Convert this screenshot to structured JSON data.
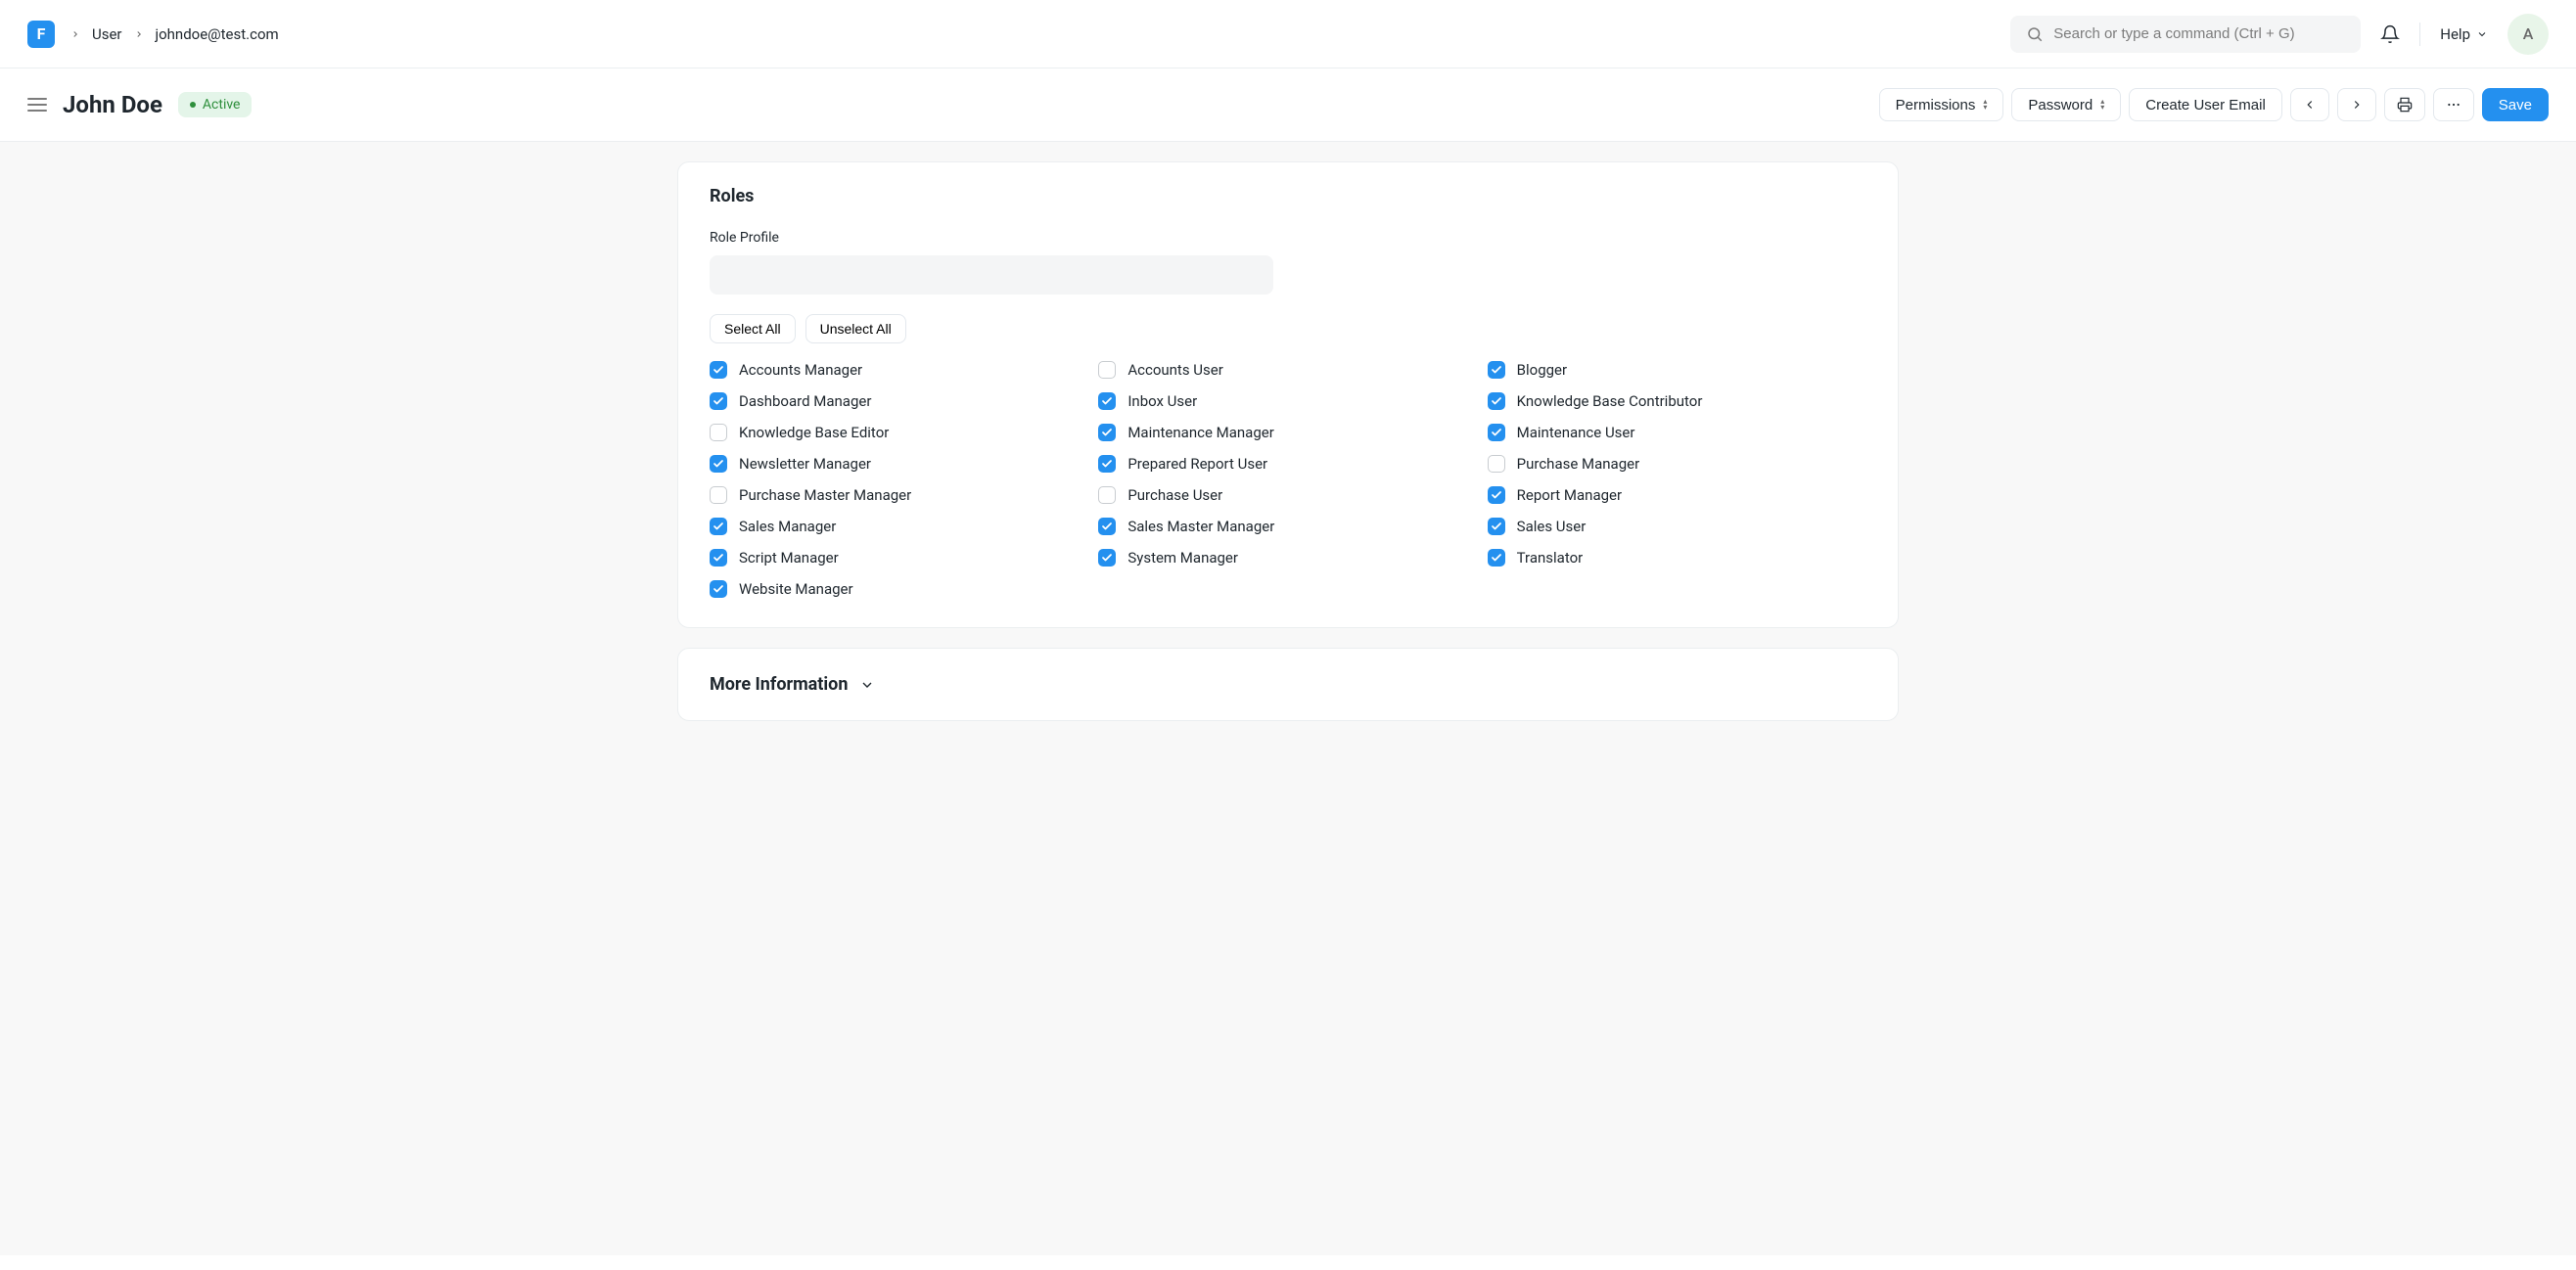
{
  "colors": {
    "primary": "#2490ef",
    "status_bg": "#e4f5e9",
    "status_fg": "#2e8f3c"
  },
  "navbar": {
    "logo_letter": "F",
    "breadcrumb": [
      "User",
      "johndoe@test.com"
    ],
    "search_placeholder": "Search or type a command (Ctrl + G)",
    "help_label": "Help",
    "avatar_letter": "A"
  },
  "header": {
    "title": "John Doe",
    "status": "Active",
    "permissions_label": "Permissions",
    "password_label": "Password",
    "create_email_label": "Create User Email",
    "save_label": "Save"
  },
  "roles": {
    "section_title": "Roles",
    "profile_label": "Role Profile",
    "profile_value": "",
    "select_all": "Select All",
    "unselect_all": "Unselect All",
    "items": [
      {
        "label": "Accounts Manager",
        "checked": true
      },
      {
        "label": "Accounts User",
        "checked": false
      },
      {
        "label": "Blogger",
        "checked": true
      },
      {
        "label": "Dashboard Manager",
        "checked": true
      },
      {
        "label": "Inbox User",
        "checked": true
      },
      {
        "label": "Knowledge Base Contributor",
        "checked": true
      },
      {
        "label": "Knowledge Base Editor",
        "checked": false
      },
      {
        "label": "Maintenance Manager",
        "checked": true
      },
      {
        "label": "Maintenance User",
        "checked": true
      },
      {
        "label": "Newsletter Manager",
        "checked": true
      },
      {
        "label": "Prepared Report User",
        "checked": true
      },
      {
        "label": "Purchase Manager",
        "checked": false
      },
      {
        "label": "Purchase Master Manager",
        "checked": false
      },
      {
        "label": "Purchase User",
        "checked": false
      },
      {
        "label": "Report Manager",
        "checked": true
      },
      {
        "label": "Sales Manager",
        "checked": true
      },
      {
        "label": "Sales Master Manager",
        "checked": true
      },
      {
        "label": "Sales User",
        "checked": true
      },
      {
        "label": "Script Manager",
        "checked": true
      },
      {
        "label": "System Manager",
        "checked": true
      },
      {
        "label": "Translator",
        "checked": true
      },
      {
        "label": "Website Manager",
        "checked": true
      }
    ]
  },
  "more_info": {
    "title": "More Information"
  }
}
